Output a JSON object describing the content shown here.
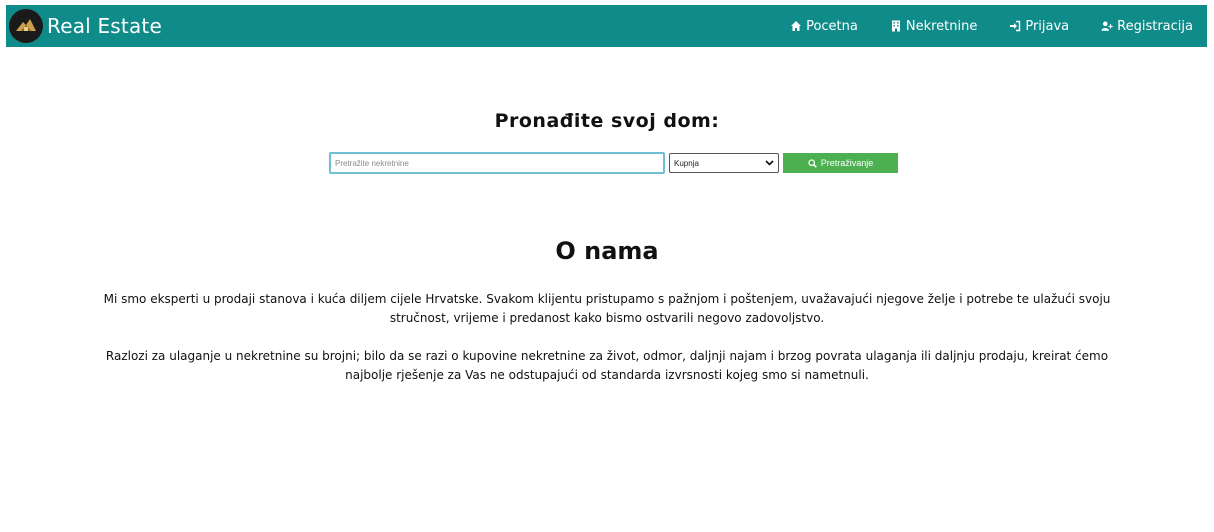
{
  "navbar": {
    "brand_title": "Real Estate",
    "links": [
      {
        "label": "Pocetna",
        "icon": "home-icon"
      },
      {
        "label": "Nekretnine",
        "icon": "building-icon"
      },
      {
        "label": "Prijava",
        "icon": "sign-in-icon"
      },
      {
        "label": "Registracija",
        "icon": "user-plus-icon"
      }
    ],
    "background_color": "#0f8c8a"
  },
  "search": {
    "heading": "Pronađite svoj dom:",
    "input_placeholder": "Pretražite nekretnine",
    "select_value": "Kupnja",
    "button_label": "Pretraživanje",
    "button_color": "#4caf50"
  },
  "about": {
    "title": "O nama",
    "paragraph_1": "Mi smo eksperti u prodaji stanova i kuća diljem cijele Hrvatske. Svakom klijentu pristupamo s pažnjom i poštenjem, uvažavajući njegove želje i potrebe te ulažući svoju stručnost, vrijeme i predanost kako bismo ostvarili negovo zadovoljstvo.",
    "paragraph_2": "Razlozi za ulaganje u nekretnine su brojni; bilo da se razi o kupovine nekretnine za život, odmor, daljnji najam i brzog povrata ulaganja ili daljnju prodaju, kreirat ćemo najbolje rješenje za Vas ne odstupajući od standarda izvrsnosti kojeg smo si nametnuli."
  }
}
